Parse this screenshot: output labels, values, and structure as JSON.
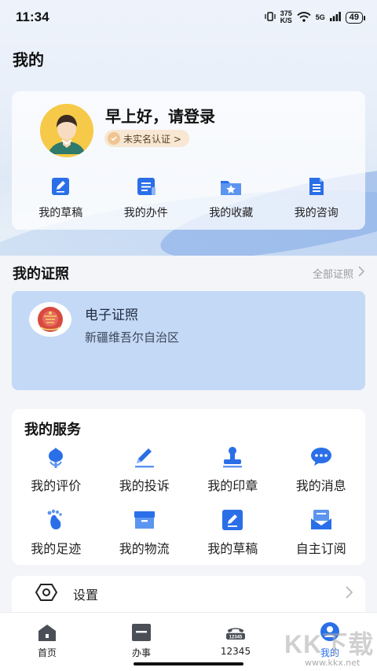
{
  "status": {
    "time": "11:34",
    "speed_top": "375",
    "speed_bottom": "K/S",
    "net": "5G",
    "battery": "49"
  },
  "page_title": "我的",
  "profile": {
    "greeting": "早上好，请登录",
    "verify_label": "未实名认证 >",
    "quick_links": [
      {
        "label": "我的草稿",
        "icon": "draft-icon"
      },
      {
        "label": "我的办件",
        "icon": "task-list-icon"
      },
      {
        "label": "我的收藏",
        "icon": "favorite-folder-icon"
      },
      {
        "label": "我的咨询",
        "icon": "consult-doc-icon"
      }
    ]
  },
  "license_section": {
    "title": "我的证照",
    "all_label": "全部证照"
  },
  "license_card": {
    "name": "电子证照",
    "region": "新疆维吾尔自治区"
  },
  "service_section": {
    "title": "我的服务",
    "items": [
      {
        "label": "我的评价",
        "icon": "evaluation-icon"
      },
      {
        "label": "我的投诉",
        "icon": "complaint-icon"
      },
      {
        "label": "我的印章",
        "icon": "seal-icon"
      },
      {
        "label": "我的消息",
        "icon": "message-icon"
      },
      {
        "label": "我的足迹",
        "icon": "footprint-icon"
      },
      {
        "label": "我的物流",
        "icon": "logistics-icon"
      },
      {
        "label": "我的草稿",
        "icon": "draft-icon"
      },
      {
        "label": "自主订阅",
        "icon": "subscribe-icon"
      }
    ]
  },
  "settings": {
    "label": "设置"
  },
  "tabbar": [
    {
      "label": "首页",
      "icon": "home-icon",
      "active": false
    },
    {
      "label": "办事",
      "icon": "service-icon",
      "active": false
    },
    {
      "label": "12345",
      "icon": "hotline-icon",
      "active": false
    },
    {
      "label": "我的",
      "icon": "profile-icon",
      "active": true
    }
  ],
  "watermark": {
    "text": "KK下载",
    "url": "www.kkx.net"
  },
  "colors": {
    "accent": "#2a6fe8",
    "license_card": "#c4d9f6",
    "page_bg": "#f3f5f9"
  }
}
